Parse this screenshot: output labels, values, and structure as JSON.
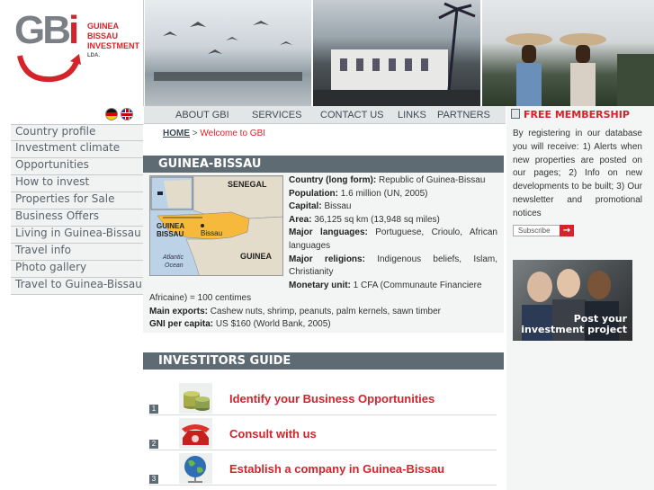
{
  "brand": {
    "logo_letters": "GB",
    "logo_i": "i",
    "name_line1": "GUINEA",
    "name_line2": "BISSAU",
    "name_line3": "INVESTMENT",
    "name_line4": "LDA."
  },
  "topnav": [
    "ABOUT GBI",
    "SERVICES",
    "CONTACT US",
    "LINKS",
    "PARTNERS"
  ],
  "sidebar": [
    "Country profile",
    "Investment climate",
    "Opportunities",
    "How to invest",
    "Properties for Sale",
    "Business Offers",
    "Living in Guinea-Bissau",
    "Travel info",
    "Photo gallery",
    "Travel to Guinea-Bissau"
  ],
  "breadcrumb": {
    "home": "HOME",
    "sep": " > ",
    "current": "Welcome to GBI"
  },
  "guinea": {
    "title": "GUINEA-BISSAU",
    "map_labels": {
      "senegal": "SENEGAL",
      "gb1": "GUINEA",
      "gb2": "BISSAU",
      "bissau": "Bissau",
      "atl1": "Atlantic",
      "atl2": "Ocean",
      "guinea": "GUINEA"
    },
    "facts": [
      {
        "k": "Country (long form):",
        "v": " Republic of Guinea-Bissau"
      },
      {
        "k": "Population:",
        "v": " 1.6 million (UN, 2005)"
      },
      {
        "k": "Capital:",
        "v": " Bissau"
      },
      {
        "k": "Area:",
        "v": " 36,125 sq km (13,948 sq miles)"
      },
      {
        "k": "Major languages:",
        "v": " Portuguese, Crioulo, African languages"
      },
      {
        "k": "Major religions:",
        "v": " Indigenous beliefs, Islam, Christianity"
      },
      {
        "k": "Monetary unit:",
        "v": " 1 CFA (Communaute Financiere"
      }
    ],
    "monetary_cont": "Africaine) = 100 centimes",
    "exports_k": "Main exports:",
    "exports_v": " Cashew nuts, shrimp, peanuts, palm kernels, sawn timber",
    "gni_k": "GNI per capita:",
    "gni_v": " US $160 (World Bank, 2005)"
  },
  "guide": {
    "title": "INVESTITORS GUIDE",
    "items": [
      {
        "num": "1",
        "label": "Identify your Business Opportunities",
        "icon": "coins-icon"
      },
      {
        "num": "2",
        "label": "Consult with us",
        "icon": "telephone-icon"
      },
      {
        "num": "3",
        "label": "Establish a company in Guinea-Bissau",
        "icon": "globe-icon"
      }
    ]
  },
  "membership": {
    "title": "FREE MEMBERSHIP",
    "text": "By registering in our database you will receive: 1) Alerts when new properties are posted on our pages; 2) Info on new developments to be built; 3) Our newsletter and promotional notices",
    "subscribe": "Subscribe",
    "arrow": "→"
  },
  "promo": {
    "line1": "Post your",
    "line2": "investment project"
  },
  "colors": {
    "accent": "#d4232a",
    "bar": "#5f6b73",
    "nav_bg": "#e3e6e7"
  }
}
